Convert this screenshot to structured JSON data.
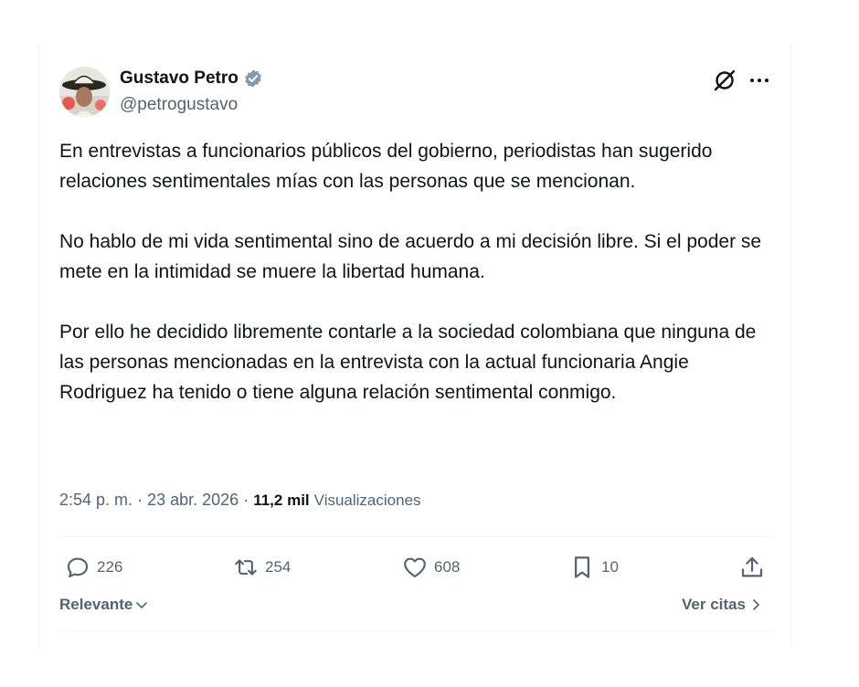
{
  "author": {
    "name": "Gustavo Petro",
    "handle": "@petrogustavo",
    "verified": true
  },
  "tweet": {
    "paragraphs": [
      "En entrevistas a funcionarios públicos del gobierno, periodistas han sugerido relaciones sentimentales mías con las personas que se mencionan.",
      "No hablo de mi vida sentimental sino de acuerdo a mi decisión libre. Si el poder se mete en la intimidad se muere la libertad humana.",
      "Por ello he decidido libremente contarle a la sociedad colombiana que ninguna de las personas mencionadas en la entrevista con la actual funcionaria Angie Rodriguez ha tenido o tiene alguna relación sentimental conmigo."
    ],
    "time": "2:54 p. m.",
    "separator": "·",
    "date": "23 abr. 2026",
    "views_count": "11,2 mil",
    "views_label": "Visualizaciones"
  },
  "actions": {
    "replies": "226",
    "reposts": "254",
    "likes": "608",
    "bookmarks": "10"
  },
  "footer": {
    "sort_label": "Relevante",
    "quotes_label": "Ver citas"
  },
  "colors": {
    "text": "#0f1419",
    "secondary": "#536471",
    "divider": "#eff3f4",
    "verified_badge": "#829aab"
  }
}
